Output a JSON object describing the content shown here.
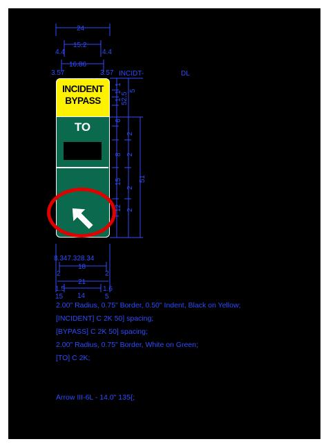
{
  "sign": {
    "line1": "INCIDENT",
    "line2": "BYPASS",
    "to": "TO",
    "colors": {
      "yellow": "#fff200",
      "green": "#0b6a4e",
      "highlight": "#e00000",
      "dimension": "#2f4cff"
    }
  },
  "labels": {
    "incidt": "INCIDT-",
    "dl": "DL"
  },
  "dims": {
    "w24": "24",
    "w152": "15.2",
    "d44a": "4.4",
    "d44b": "4.4",
    "w1686": "16.86",
    "d357a": "3.57",
    "d357b": "3.57",
    "v1a": "1",
    "v1b": "1",
    "v1c": "1",
    "v525": "52.5",
    "v5": "5",
    "v6": "6",
    "v2a": "2",
    "v8": "8",
    "v2b": "2",
    "v15": "15",
    "v51": "51",
    "v12": "12",
    "v2c": "2",
    "v2d": "2",
    "b8347": "8.347.328.34",
    "w18": "18",
    "s2a": "2",
    "s2b": "2",
    "w21": "21",
    "s15": "1.5",
    "s16": "1.6",
    "b15": "15",
    "w14": "14",
    "b5": "5"
  },
  "notes": [
    "2.00\" Radius, 0.75\" Border, 0.50\" Indent, Black on Yellow;",
    "[INCIDENT] C 2K 50] spacing;",
    "[BYPASS] C 2K 50] spacing;",
    "2.00\" Radius, 0.75\" Border, White on Green;",
    "[TO] C 2K;",
    "",
    "",
    "Arrow III-6L - 14.0\" 135{;"
  ]
}
